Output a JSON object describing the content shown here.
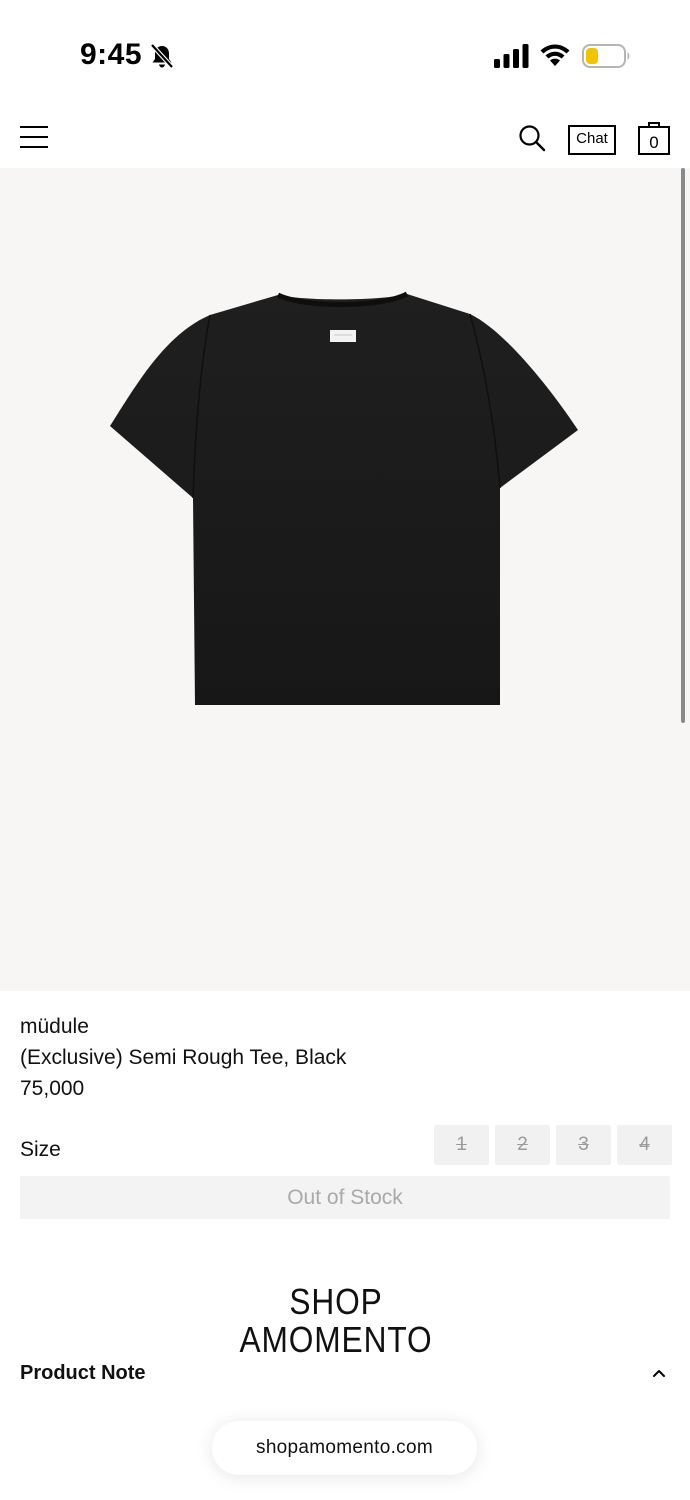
{
  "status_bar": {
    "time": "9:45",
    "icons": [
      "bell-slash-icon",
      "signal-icon",
      "wifi-icon",
      "battery-icon"
    ],
    "battery_color": "#f5c400"
  },
  "header": {
    "icons": [
      "menu-icon",
      "search-icon",
      "cart-icon"
    ],
    "chat_label": "Chat",
    "cart_count": "0"
  },
  "product": {
    "image_icon": "black-tshirt-image",
    "brand": "müdule",
    "name": "(Exclusive) Semi Rough Tee, Black",
    "price": "75,000",
    "colors": {
      "image_background": "#f7f6f4",
      "tee": "#1b1b1b"
    }
  },
  "size": {
    "label": "Size",
    "options": [
      "1",
      "2",
      "3",
      "4"
    ],
    "all_unavailable": true
  },
  "stock_button": {
    "label": "Out of Stock"
  },
  "shop_logo": {
    "line1": "SHOP",
    "line2": "AMOMENTO"
  },
  "product_note": {
    "label": "Product Note",
    "expanded": true
  },
  "url_bar": {
    "domain": "shopamomento.com"
  }
}
